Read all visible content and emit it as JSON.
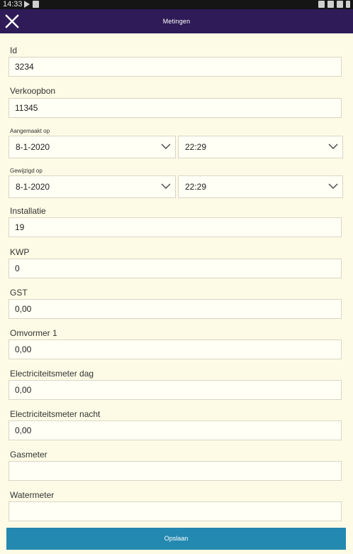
{
  "status_bar": {
    "time": "14:33"
  },
  "header": {
    "title": "Metingen"
  },
  "form": {
    "id": {
      "label": "Id",
      "value": "3234"
    },
    "verkoopbon": {
      "label": "Verkoopbon",
      "value": "11345"
    },
    "aangemaakt": {
      "label": "Aangemaakt op",
      "date": "8-1-2020",
      "time": "22:29"
    },
    "gewijzigd": {
      "label": "Gewijzigd op",
      "date": "8-1-2020",
      "time": "22:29"
    },
    "installatie": {
      "label": "Installatie",
      "value": "19"
    },
    "kwp": {
      "label": "KWP",
      "value": "0"
    },
    "gst": {
      "label": "GST",
      "value": "0,00"
    },
    "omvormer1": {
      "label": "Omvormer 1",
      "value": "0,00"
    },
    "elec_dag": {
      "label": "Electriciteitsmeter dag",
      "value": "0,00"
    },
    "elec_nacht": {
      "label": "Electriciteitsmeter nacht",
      "value": "0,00"
    },
    "gasmeter": {
      "label": "Gasmeter",
      "value": ""
    },
    "watermeter": {
      "label": "Watermeter",
      "value": ""
    }
  },
  "actions": {
    "save_label": "Opslaan"
  },
  "colors": {
    "app_bar": "#2e1b57",
    "background": "#fdfbe6",
    "save_button": "#2489b0"
  }
}
